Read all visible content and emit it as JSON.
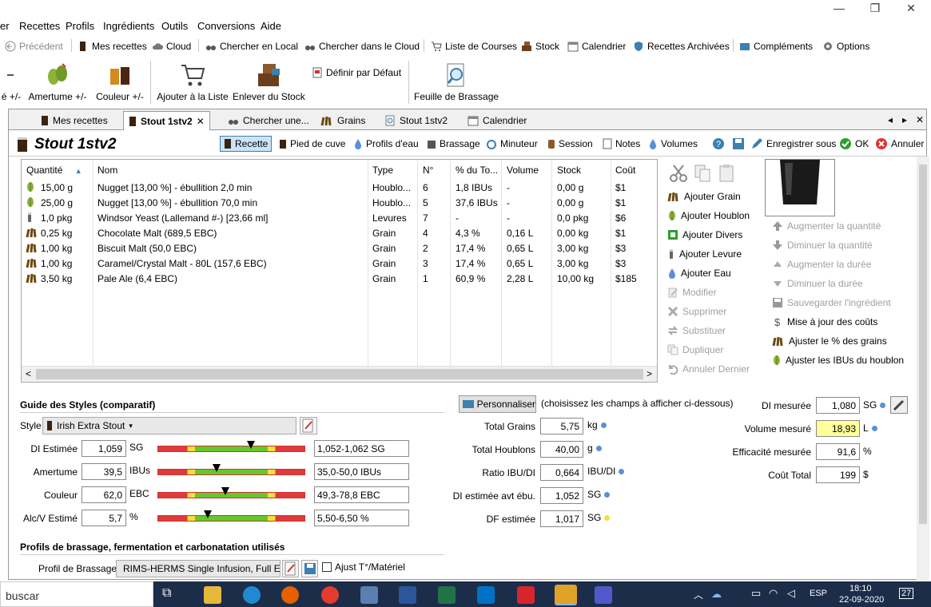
{
  "menu": [
    "er",
    "Recettes",
    "Profils",
    "Ingrédients",
    "Outils",
    "Conversions",
    "Aide"
  ],
  "window_controls": {
    "minimize": "—",
    "restore": "❐",
    "close": "✕"
  },
  "toolbar1": {
    "previous": "Précédent",
    "my_recipes": "Mes recettes",
    "cloud": "Cloud",
    "search_local": "Chercher en Local",
    "search_cloud": "Chercher dans le Cloud",
    "shopping_list": "Liste de Courses",
    "stock": "Stock",
    "calendar": "Calendrier",
    "archived": "Recettes Archivées",
    "addons": "Compléments",
    "options": "Options"
  },
  "toolbar2": {
    "partial": "é +/-",
    "bitterness": "Amertume +/-",
    "color": "Couleur +/-",
    "add_list": "Ajouter à la Liste",
    "remove_stock": "Enlever du Stock",
    "set_default": "Définir par Défaut",
    "brew_sheet": "Feuille de Brassage"
  },
  "tabs": [
    "Mes recettes",
    "Stout 1stv2",
    "Chercher une...",
    "Grains",
    "Stout 1stv2",
    "Calendrier"
  ],
  "tab_close": "✕",
  "tab_nav": [
    "◂",
    "▸",
    "✕"
  ],
  "recipe_title": "Stout 1stv2",
  "subtools": {
    "recipe": "Recette",
    "mash_tun": "Pied de cuve",
    "water_profiles": "Profils d'eau",
    "brewing": "Brassage",
    "timer": "Minuteur",
    "session": "Session",
    "notes": "Notes",
    "volumes": "Volumes",
    "save_as": "Enregistrer sous",
    "ok": "OK",
    "cancel": "Annuler"
  },
  "grid": {
    "headers": [
      "Quantité",
      "Nom",
      "Type",
      "N°",
      "% du To...",
      "Volume",
      "Stock",
      "Coût"
    ],
    "sort_arrow": "▲",
    "rows": [
      {
        "icon": "hop",
        "qty": "15,00 g",
        "name": "Nugget [13,00 %] - ébullition 2,0 min",
        "type": "Houblo...",
        "n": "6",
        "pct": "1,8 IBUs",
        "vol": "-",
        "stock": "0,00 g",
        "cost": "$1"
      },
      {
        "icon": "hop",
        "qty": "25,00 g",
        "name": "Nugget [13,00 %] - ébullition 70,0 min",
        "type": "Houblo...",
        "n": "5",
        "pct": "37,6 IBUs",
        "vol": "-",
        "stock": "0,00 g",
        "cost": "$1"
      },
      {
        "icon": "yeast",
        "qty": "1,0 pkg",
        "name": "Windsor Yeast (Lallemand #-) [23,66 ml]",
        "type": "Levures",
        "n": "7",
        "pct": "-",
        "vol": "-",
        "stock": "0,0 pkg",
        "cost": "$6"
      },
      {
        "icon": "grain",
        "qty": "0,25 kg",
        "name": "Chocolate Malt (689,5 EBC)",
        "type": "Grain",
        "n": "4",
        "pct": "4,3 %",
        "vol": "0,16 L",
        "stock": "0,00 kg",
        "cost": "$1"
      },
      {
        "icon": "grain",
        "qty": "1,00 kg",
        "name": "Biscuit Malt (50,0 EBC)",
        "type": "Grain",
        "n": "2",
        "pct": "17,4 %",
        "vol": "0,65 L",
        "stock": "3,00 kg",
        "cost": "$3"
      },
      {
        "icon": "grain",
        "qty": "1,00 kg",
        "name": "Caramel/Crystal Malt - 80L (157,6 EBC)",
        "type": "Grain",
        "n": "3",
        "pct": "17,4 %",
        "vol": "0,65 L",
        "stock": "3,00 kg",
        "cost": "$3"
      },
      {
        "icon": "grain",
        "qty": "3,50 kg",
        "name": "Pale Ale (6,4 EBC)",
        "type": "Grain",
        "n": "1",
        "pct": "60,9 %",
        "vol": "2,28 L",
        "stock": "10,00 kg",
        "cost": "$185"
      }
    ],
    "scroll_left": "<",
    "scroll_right": ">"
  },
  "actions_mid": [
    {
      "label": "Ajouter Grain",
      "enabled": true,
      "icon": "grain"
    },
    {
      "label": "Ajouter Houblon",
      "enabled": true,
      "icon": "hop"
    },
    {
      "label": "Ajouter Divers",
      "enabled": true,
      "icon": "misc"
    },
    {
      "label": "Ajouter Levure",
      "enabled": true,
      "icon": "yeast"
    },
    {
      "label": "Ajouter Eau",
      "enabled": true,
      "icon": "water"
    },
    {
      "label": "Modifier",
      "enabled": false,
      "icon": "edit"
    },
    {
      "label": "Supprimer",
      "enabled": false,
      "icon": "delete"
    },
    {
      "label": "Substituer",
      "enabled": false,
      "icon": "swap"
    },
    {
      "label": "Dupliquer",
      "enabled": false,
      "icon": "copy"
    },
    {
      "label": "Annuler Dernier",
      "enabled": false,
      "icon": "undo"
    }
  ],
  "actions_right": [
    {
      "label": "Augmenter la quantité",
      "enabled": false,
      "icon": "up"
    },
    {
      "label": "Diminuer la quantité",
      "enabled": false,
      "icon": "down"
    },
    {
      "label": "Augmenter la durée",
      "enabled": false,
      "icon": "up-small"
    },
    {
      "label": "Diminuer la durée",
      "enabled": false,
      "icon": "down-small"
    },
    {
      "label": "Sauvegarder l'ingrédient",
      "enabled": false,
      "icon": "save"
    },
    {
      "label": "Mise à jour des coûts",
      "enabled": true,
      "icon": "dollar"
    },
    {
      "label": "Ajuster le % des grains",
      "enabled": true,
      "icon": "grain"
    },
    {
      "label": "Ajuster les IBUs du houblon",
      "enabled": true,
      "icon": "hop"
    }
  ],
  "style_guide": {
    "heading": "Guide des Styles (comparatif)",
    "style_label": "Style",
    "style_value": "Irish Extra Stout",
    "rows": [
      {
        "label": "DI Estimée",
        "value": "1,059",
        "unit": "SG",
        "range": "1,052-1,062 SG",
        "marker": 0.63
      },
      {
        "label": "Amertume",
        "value": "39,5",
        "unit": "IBUs",
        "range": "35,0-50,0 IBUs",
        "marker": 0.4
      },
      {
        "label": "Couleur",
        "value": "62,0",
        "unit": "EBC",
        "range": "49,3-78,8 EBC",
        "marker": 0.46
      },
      {
        "label": "Alc/V Estimé",
        "value": "5,7",
        "unit": "%",
        "range": "5,50-6,50 %",
        "marker": 0.34
      }
    ]
  },
  "profiles": {
    "heading": "Profils de brassage, fermentation et carbonatation utilisés",
    "brew_profile_label": "Profil de Brassage",
    "brew_profile_value": "RIMS-HERMS Single Infusion, Full E",
    "adjust_label": "Ajust T°/Matériel"
  },
  "customize": {
    "button": "Personnaliser",
    "hint": "(choisissez les champs à afficher ci-dessous)"
  },
  "stats": [
    {
      "label": "Total Grains",
      "value": "5,75",
      "unit": "kg",
      "dot": "blue"
    },
    {
      "label": "Total Houblons",
      "value": "40,00",
      "unit": "g",
      "dot": "blue"
    },
    {
      "label": "Ratio IBU/DI",
      "value": "0,664",
      "unit": "IBU/DI",
      "dot": "blue"
    },
    {
      "label": "DI estimée avt ébu.",
      "value": "1,052",
      "unit": "SG",
      "dot": "blue"
    },
    {
      "label": "DF estimée",
      "value": "1,017",
      "unit": "SG",
      "dot": "yellow"
    }
  ],
  "measured": [
    {
      "label": "DI mesurée",
      "value": "1,080",
      "unit": "SG",
      "highlight": false
    },
    {
      "label": "Volume mesuré",
      "value": "18,93",
      "unit": "L",
      "highlight": true
    },
    {
      "label": "Efficacité mesurée",
      "value": "91,6",
      "unit": "%",
      "highlight": false
    },
    {
      "label": "Coût Total",
      "value": "199",
      "unit": "$",
      "highlight": false
    }
  ],
  "taskbar": {
    "search": "buscar",
    "lang": "ESP",
    "time": "18:10",
    "date": "22-09-2020",
    "notif": "27"
  },
  "colors": {
    "accent": "#3c7fb1",
    "taskbar": "#1c2d4a",
    "highlight": "#ffff99"
  }
}
